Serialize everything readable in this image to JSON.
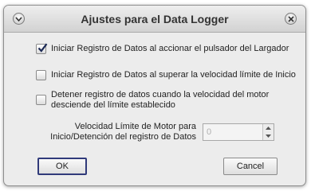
{
  "window": {
    "title": "Ajustes para el Data Logger"
  },
  "options": [
    {
      "label": "Iniciar Registro de Datos al accionar el pulsador del Largador",
      "checked": true
    },
    {
      "label": "Iniciar Registro de Datos al superar la velocidad límite de Inicio",
      "checked": false
    },
    {
      "label_line1": "Detener registro de datos cuando la velocidad del motor",
      "label_line2": "desciende del límite establecido",
      "checked": false
    }
  ],
  "speed_limit": {
    "label_line1": "Velocidad Límite de Motor para",
    "label_line2": "Inicio/Detención del registro de Datos",
    "value": "0"
  },
  "buttons": {
    "ok": "OK",
    "cancel": "Cancel"
  },
  "icons": {
    "menu": "chevron-down-icon",
    "close": "close-icon",
    "check": "checkmark-icon",
    "spin_up": "triangle-up-icon",
    "spin_down": "triangle-down-icon"
  }
}
